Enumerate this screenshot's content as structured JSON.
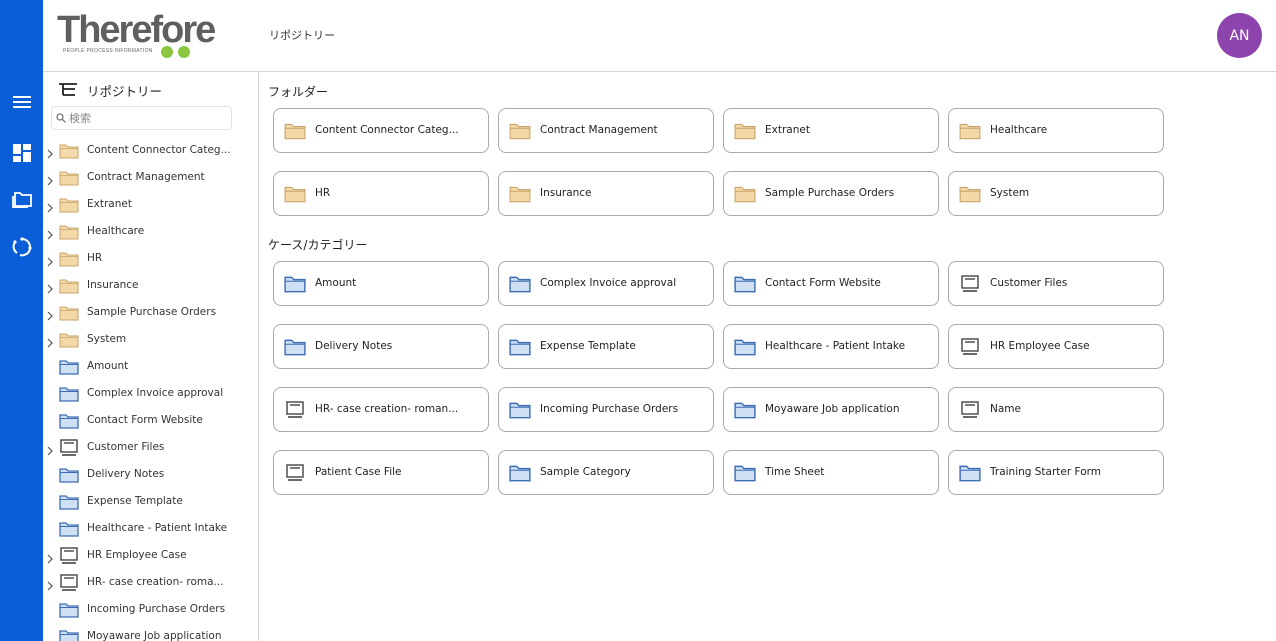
{
  "header": {
    "logo_text": "Therefore",
    "logo_tagline": "PEOPLE  PROCESS  INFORMATION",
    "breadcrumb": "リポジトリー",
    "avatar_initials": "AN",
    "avatar_color": "#8e44ad"
  },
  "rail": {
    "color": "#0a5fd8",
    "items": [
      {
        "icon": "menu-icon"
      },
      {
        "icon": "dashboard-icon"
      },
      {
        "icon": "repository-icon"
      },
      {
        "icon": "workflow-icon"
      }
    ]
  },
  "sidebar": {
    "title": "リポジトリー",
    "search_placeholder": "検索",
    "items": [
      {
        "label": "Content Connector Categ...",
        "icon": "folder",
        "expandable": true
      },
      {
        "label": "Contract Management",
        "icon": "folder",
        "expandable": true
      },
      {
        "label": "Extranet",
        "icon": "folder",
        "expandable": true
      },
      {
        "label": "Healthcare",
        "icon": "folder",
        "expandable": true
      },
      {
        "label": "HR",
        "icon": "folder",
        "expandable": true
      },
      {
        "label": "Insurance",
        "icon": "folder",
        "expandable": true
      },
      {
        "label": "Sample Purchase Orders",
        "icon": "folder",
        "expandable": true
      },
      {
        "label": "System",
        "icon": "folder",
        "expandable": true
      },
      {
        "label": "Amount",
        "icon": "category",
        "expandable": false
      },
      {
        "label": "Complex Invoice approval",
        "icon": "category",
        "expandable": false
      },
      {
        "label": "Contact Form Website",
        "icon": "category",
        "expandable": false
      },
      {
        "label": "Customer Files",
        "icon": "case",
        "expandable": true
      },
      {
        "label": "Delivery Notes",
        "icon": "category",
        "expandable": false
      },
      {
        "label": "Expense Template",
        "icon": "category",
        "expandable": false
      },
      {
        "label": "Healthcare - Patient Intake",
        "icon": "category",
        "expandable": false
      },
      {
        "label": "HR Employee Case",
        "icon": "case",
        "expandable": true
      },
      {
        "label": "HR- case creation- roma...",
        "icon": "case",
        "expandable": true
      },
      {
        "label": "Incoming Purchase Orders",
        "icon": "category",
        "expandable": false
      },
      {
        "label": "Moyaware Job application",
        "icon": "category",
        "expandable": false
      }
    ]
  },
  "main": {
    "folders_title": "フォルダー",
    "folders": [
      {
        "label": "Content Connector Categ...",
        "icon": "folder"
      },
      {
        "label": "Contract Management",
        "icon": "folder"
      },
      {
        "label": "Extranet",
        "icon": "folder"
      },
      {
        "label": "Healthcare",
        "icon": "folder"
      },
      {
        "label": "HR",
        "icon": "folder"
      },
      {
        "label": "Insurance",
        "icon": "folder"
      },
      {
        "label": "Sample Purchase Orders",
        "icon": "folder"
      },
      {
        "label": "System",
        "icon": "folder"
      }
    ],
    "categories_title": "ケース/カテゴリー",
    "categories": [
      {
        "label": "Amount",
        "icon": "category"
      },
      {
        "label": "Complex Invoice approval",
        "icon": "category"
      },
      {
        "label": "Contact Form Website",
        "icon": "category"
      },
      {
        "label": "Customer Files",
        "icon": "case"
      },
      {
        "label": "Delivery Notes",
        "icon": "category"
      },
      {
        "label": "Expense Template",
        "icon": "category"
      },
      {
        "label": "Healthcare - Patient Intake",
        "icon": "category"
      },
      {
        "label": "HR Employee Case",
        "icon": "case"
      },
      {
        "label": "HR- case creation- roman...",
        "icon": "case"
      },
      {
        "label": "Incoming Purchase Orders",
        "icon": "category"
      },
      {
        "label": "Moyaware Job application",
        "icon": "category"
      },
      {
        "label": "Name",
        "icon": "case"
      },
      {
        "label": "Patient Case File",
        "icon": "case"
      },
      {
        "label": "Sample Category",
        "icon": "category"
      },
      {
        "label": "Time Sheet",
        "icon": "category"
      },
      {
        "label": "Training Starter Form",
        "icon": "category"
      }
    ]
  },
  "colors": {
    "folder": "#f3d9a8",
    "folder_stroke": "#c9a46a",
    "category": "#cfe0f5",
    "category_stroke": "#3d6db5",
    "case_stroke": "#444444",
    "logo_accent": "#8cc63f"
  }
}
